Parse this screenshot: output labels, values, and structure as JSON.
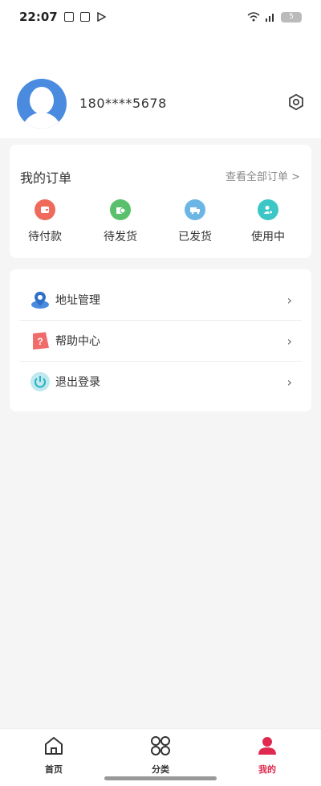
{
  "status_bar": {
    "time": "22:07",
    "battery": "5"
  },
  "profile": {
    "phone": "180****5678"
  },
  "orders": {
    "title": "我的订单",
    "view_all": "查看全部订单 >",
    "items": [
      {
        "label": "待付款",
        "icon": "wallet-icon",
        "color": "#ef6a5a"
      },
      {
        "label": "待发货",
        "icon": "package-icon",
        "color": "#5bc06b"
      },
      {
        "label": "已发货",
        "icon": "truck-icon",
        "color": "#6cb6e6"
      },
      {
        "label": "使用中",
        "icon": "user-check-icon",
        "color": "#3cc6c6"
      }
    ]
  },
  "menu": {
    "items": [
      {
        "label": "地址管理",
        "icon": "location-pin-icon"
      },
      {
        "label": "帮助中心",
        "icon": "help-icon"
      },
      {
        "label": "退出登录",
        "icon": "power-icon"
      }
    ]
  },
  "tabbar": {
    "tabs": [
      {
        "label": "首页",
        "icon": "home-icon"
      },
      {
        "label": "分类",
        "icon": "grid-icon"
      },
      {
        "label": "我的",
        "icon": "profile-icon",
        "active": true
      }
    ]
  },
  "colors": {
    "accent": "#e0294e",
    "avatar_bg": "#4a8be0"
  }
}
